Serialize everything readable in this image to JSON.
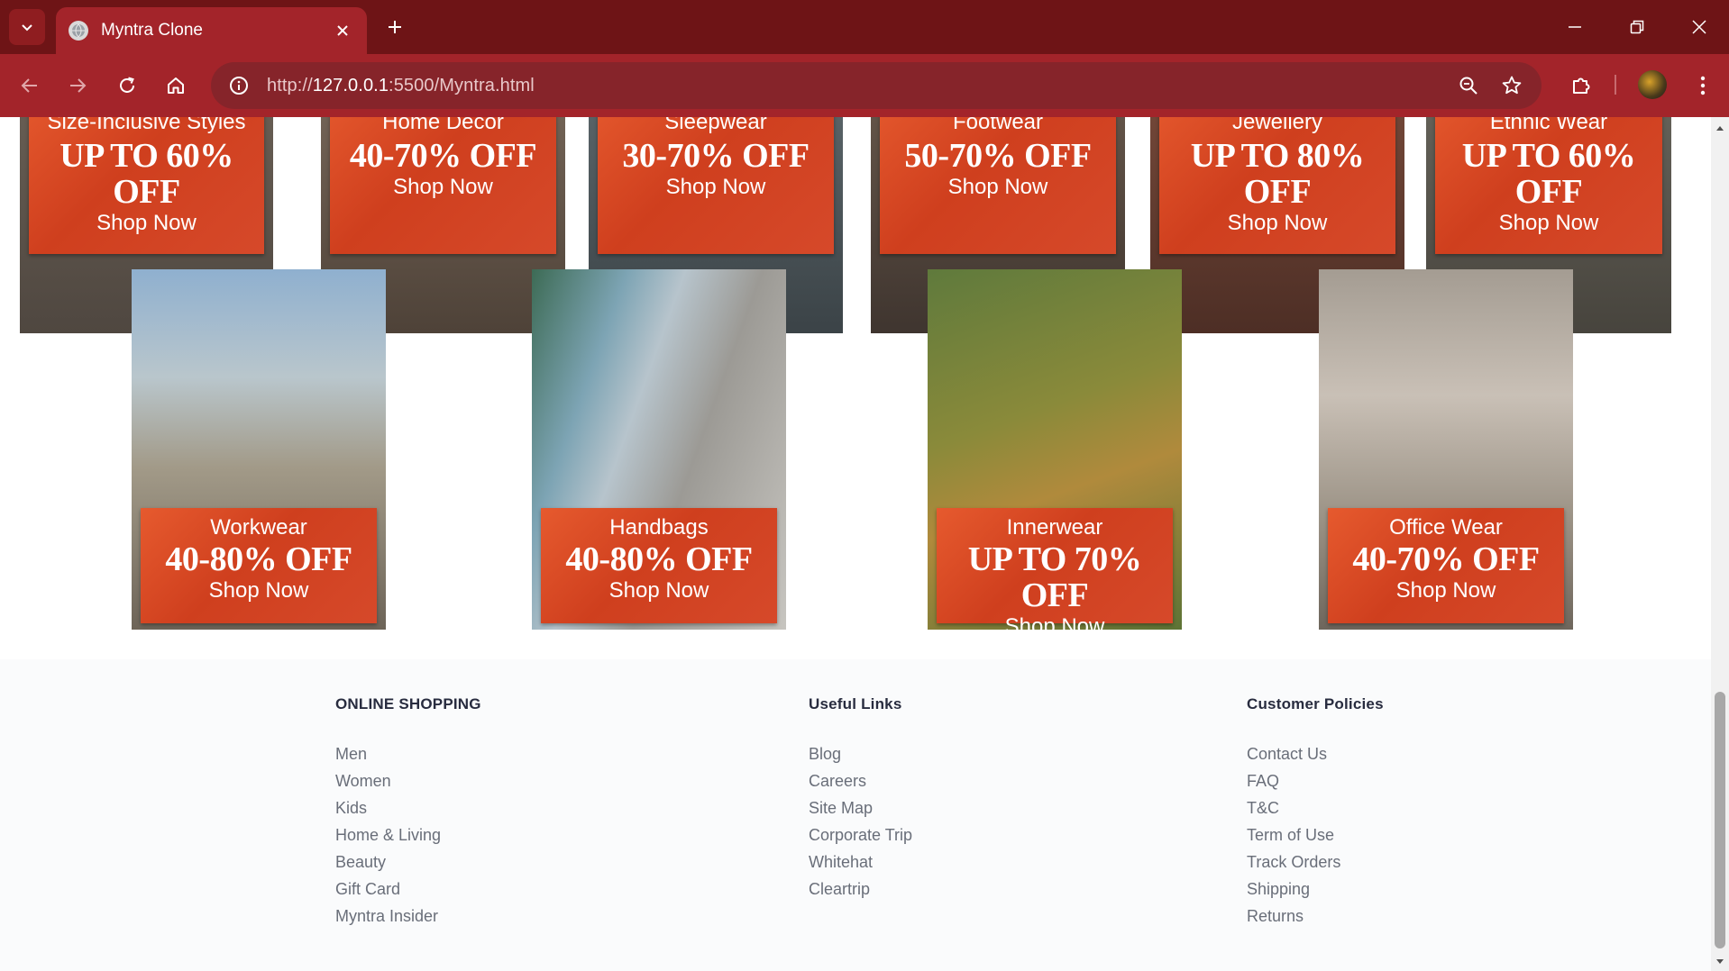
{
  "browser": {
    "tab_title": "Myntra Clone",
    "url_scheme": "http://",
    "url_host": "127.0.0.1",
    "url_path": ":5500/Myntra.html"
  },
  "top_banners": [
    {
      "category": "Size-Inclusive Styles",
      "offer": "UP TO 60% OFF",
      "cta": "Shop Now"
    },
    {
      "category": "Home Decor",
      "offer": "40-70% OFF",
      "cta": "Shop Now"
    },
    {
      "category": "Sleepwear",
      "offer": "30-70% OFF",
      "cta": "Shop Now"
    },
    {
      "category": "Footwear",
      "offer": "50-70% OFF",
      "cta": "Shop Now"
    },
    {
      "category": "Jewellery",
      "offer": "UP TO 80% OFF",
      "cta": "Shop Now"
    },
    {
      "category": "Ethnic Wear",
      "offer": "UP TO 60% OFF",
      "cta": "Shop Now"
    }
  ],
  "mid_banners": [
    {
      "category": "Workwear",
      "offer": "40-80% OFF",
      "cta": "Shop Now"
    },
    {
      "category": "Handbags",
      "offer": "40-80% OFF",
      "cta": "Shop Now"
    },
    {
      "category": "Innerwear",
      "offer": "UP TO 70% OFF",
      "cta": "Shop Now"
    },
    {
      "category": "Office Wear",
      "offer": "40-70% OFF",
      "cta": "Shop Now"
    }
  ],
  "footer": {
    "online_shopping": {
      "heading": "ONLINE SHOPPING",
      "links": [
        "Men",
        "Women",
        "Kids",
        "Home & Living",
        "Beauty",
        "Gift Card",
        "Myntra Insider"
      ]
    },
    "useful_links": {
      "heading": "Useful Links",
      "links": [
        "Blog",
        "Careers",
        "Site Map",
        "Corporate Trip",
        "Whitehat",
        "Cleartrip"
      ]
    },
    "customer_policies": {
      "heading": "Customer Policies",
      "links": [
        "Contact Us",
        "FAQ",
        "T&C",
        "Term of Use",
        "Track Orders",
        "Shipping",
        "Returns"
      ]
    }
  },
  "colors": {
    "browser_frame": "#6e1416",
    "toolbar": "#a3242a",
    "promo_orange": "#d6492a",
    "footer_bg": "#fafbfc"
  }
}
